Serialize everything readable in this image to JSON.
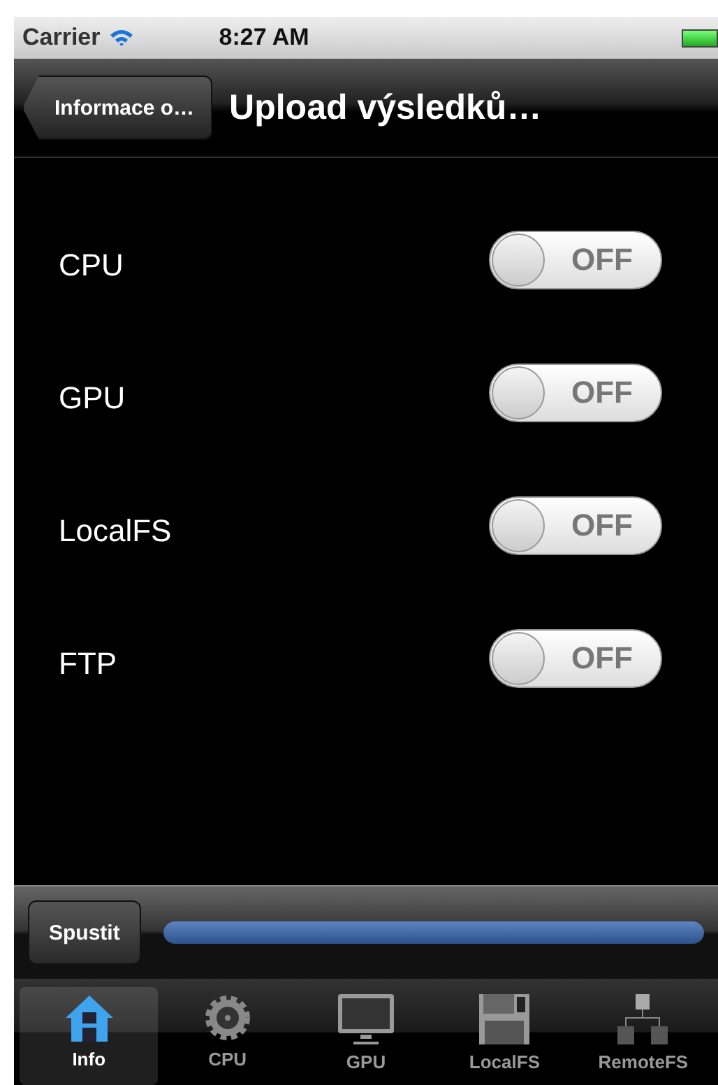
{
  "status_bar": {
    "carrier": "Carrier",
    "time": "8:27 AM"
  },
  "nav_bar": {
    "back": "Informace o…",
    "title": "Upload výsledků…"
  },
  "settings": [
    {
      "label": "CPU",
      "switch_text": "OFF",
      "on": false
    },
    {
      "label": "GPU",
      "switch_text": "OFF",
      "on": false
    },
    {
      "label": "LocalFS",
      "switch_text": "OFF",
      "on": false
    },
    {
      "label": "FTP",
      "switch_text": "OFF",
      "on": false
    }
  ],
  "toolbar": {
    "button": "Spustit",
    "progress": {
      "level": 1
    }
  },
  "tabs": [
    {
      "label": "Info",
      "kind": "house",
      "selected": true
    },
    {
      "label": "CPU",
      "kind": "gear",
      "selected": false
    },
    {
      "label": "GPU",
      "kind": "monitor",
      "selected": false
    },
    {
      "label": "LocalFS",
      "kind": "floppy",
      "selected": false
    },
    {
      "label": "RemoteFS",
      "kind": "network",
      "selected": false
    }
  ]
}
